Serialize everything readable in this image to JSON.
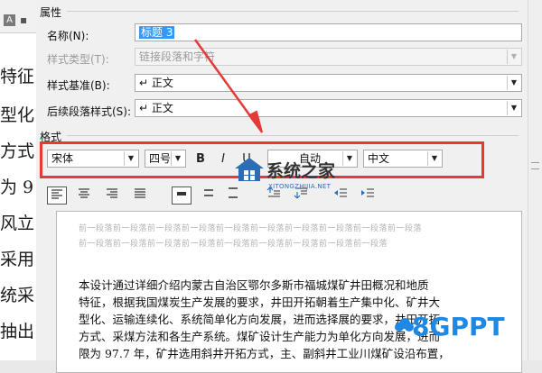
{
  "background_doc": {
    "format_icon": "A",
    "lines": [
      "特征",
      "型化",
      "方式",
      "为 9",
      "风立",
      "采用",
      "统采",
      "抽出"
    ]
  },
  "dialog": {
    "properties_group": "属性",
    "format_group": "格式",
    "name_label": "名称(N):",
    "name_value": "标题 3",
    "style_type_label": "样式类型(T):",
    "style_type_value": "链接段落和字符",
    "style_based_label": "样式基准(B):",
    "style_based_value": "↵ 正文",
    "following_label": "后续段落样式(S):",
    "following_value": "↵ 正文"
  },
  "format_toolbar": {
    "font_value": "宋体",
    "size_value": "四号",
    "bold": "B",
    "italic": "I",
    "underline": "U",
    "color_value": "自动",
    "language_value": "中文"
  },
  "preview": {
    "prev_para_1": "前一段落前一段落前一段落前一段落前一段落前一段落前一段落前一段落前一段落前一段落",
    "prev_para_2": "前一段落前一段落前一段落前一段落前一段落前一段落前一段落前一段落前一段落",
    "body_lines": [
      "本设计通过详细介绍内蒙古自治区鄂尔多斯市福城煤矿井田概况和地质",
      "特征，根据我国煤炭生产发展的要求，井田开拓朝着生产集中化、矿井大",
      "型化、运输连续化、系统简单化方向发展，进而选择展的要求，井田开拓",
      "方式、采煤方法和各生产系统。煤矿设计生产能力为单化方向发展，进而",
      "限为 97.7 年，矿井选用斜井开拓方式，主、副斜井工业川煤矿设沿布置，"
    ]
  },
  "watermark": {
    "title": "系统之家",
    "url": "XITONGZHIJIA.NET"
  },
  "brand": "8GPPT",
  "colors": {
    "highlight_red": "#e53935",
    "selection_blue": "#3399ff",
    "brand_blue": "#1e88e5"
  }
}
